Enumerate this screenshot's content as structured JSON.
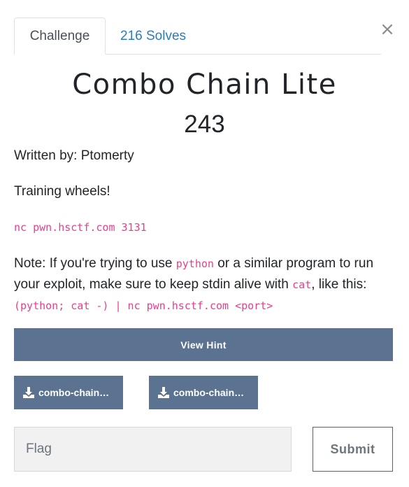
{
  "tabs": [
    {
      "label": "Challenge"
    },
    {
      "label": "216 Solves"
    }
  ],
  "close_label": "×",
  "challenge": {
    "title": "Combo Chain Lite",
    "points": "243",
    "author": "Written by: Ptomerty",
    "description": "Training wheels!",
    "command": "nc pwn.hsctf.com 3131",
    "note": {
      "part1": "Note: If you're trying to use ",
      "code1": "python",
      "part2": " or a similar program to run your exploit, make sure to keep stdin alive with ",
      "code2": "cat",
      "part3": ", like this: ",
      "code3": "(python; cat -) | nc pwn.hsctf.com <port>"
    }
  },
  "hint_button": "View Hint",
  "files": [
    {
      "label": "combo-chain…",
      "icon": "download-icon"
    },
    {
      "label": "combo-chain…",
      "icon": "download-icon"
    }
  ],
  "flag_input": {
    "placeholder": "Flag",
    "value": ""
  },
  "submit_label": "Submit",
  "colors": {
    "accent": "#5b7290",
    "link": "#2a7cc1",
    "code": "#e83e8c"
  }
}
